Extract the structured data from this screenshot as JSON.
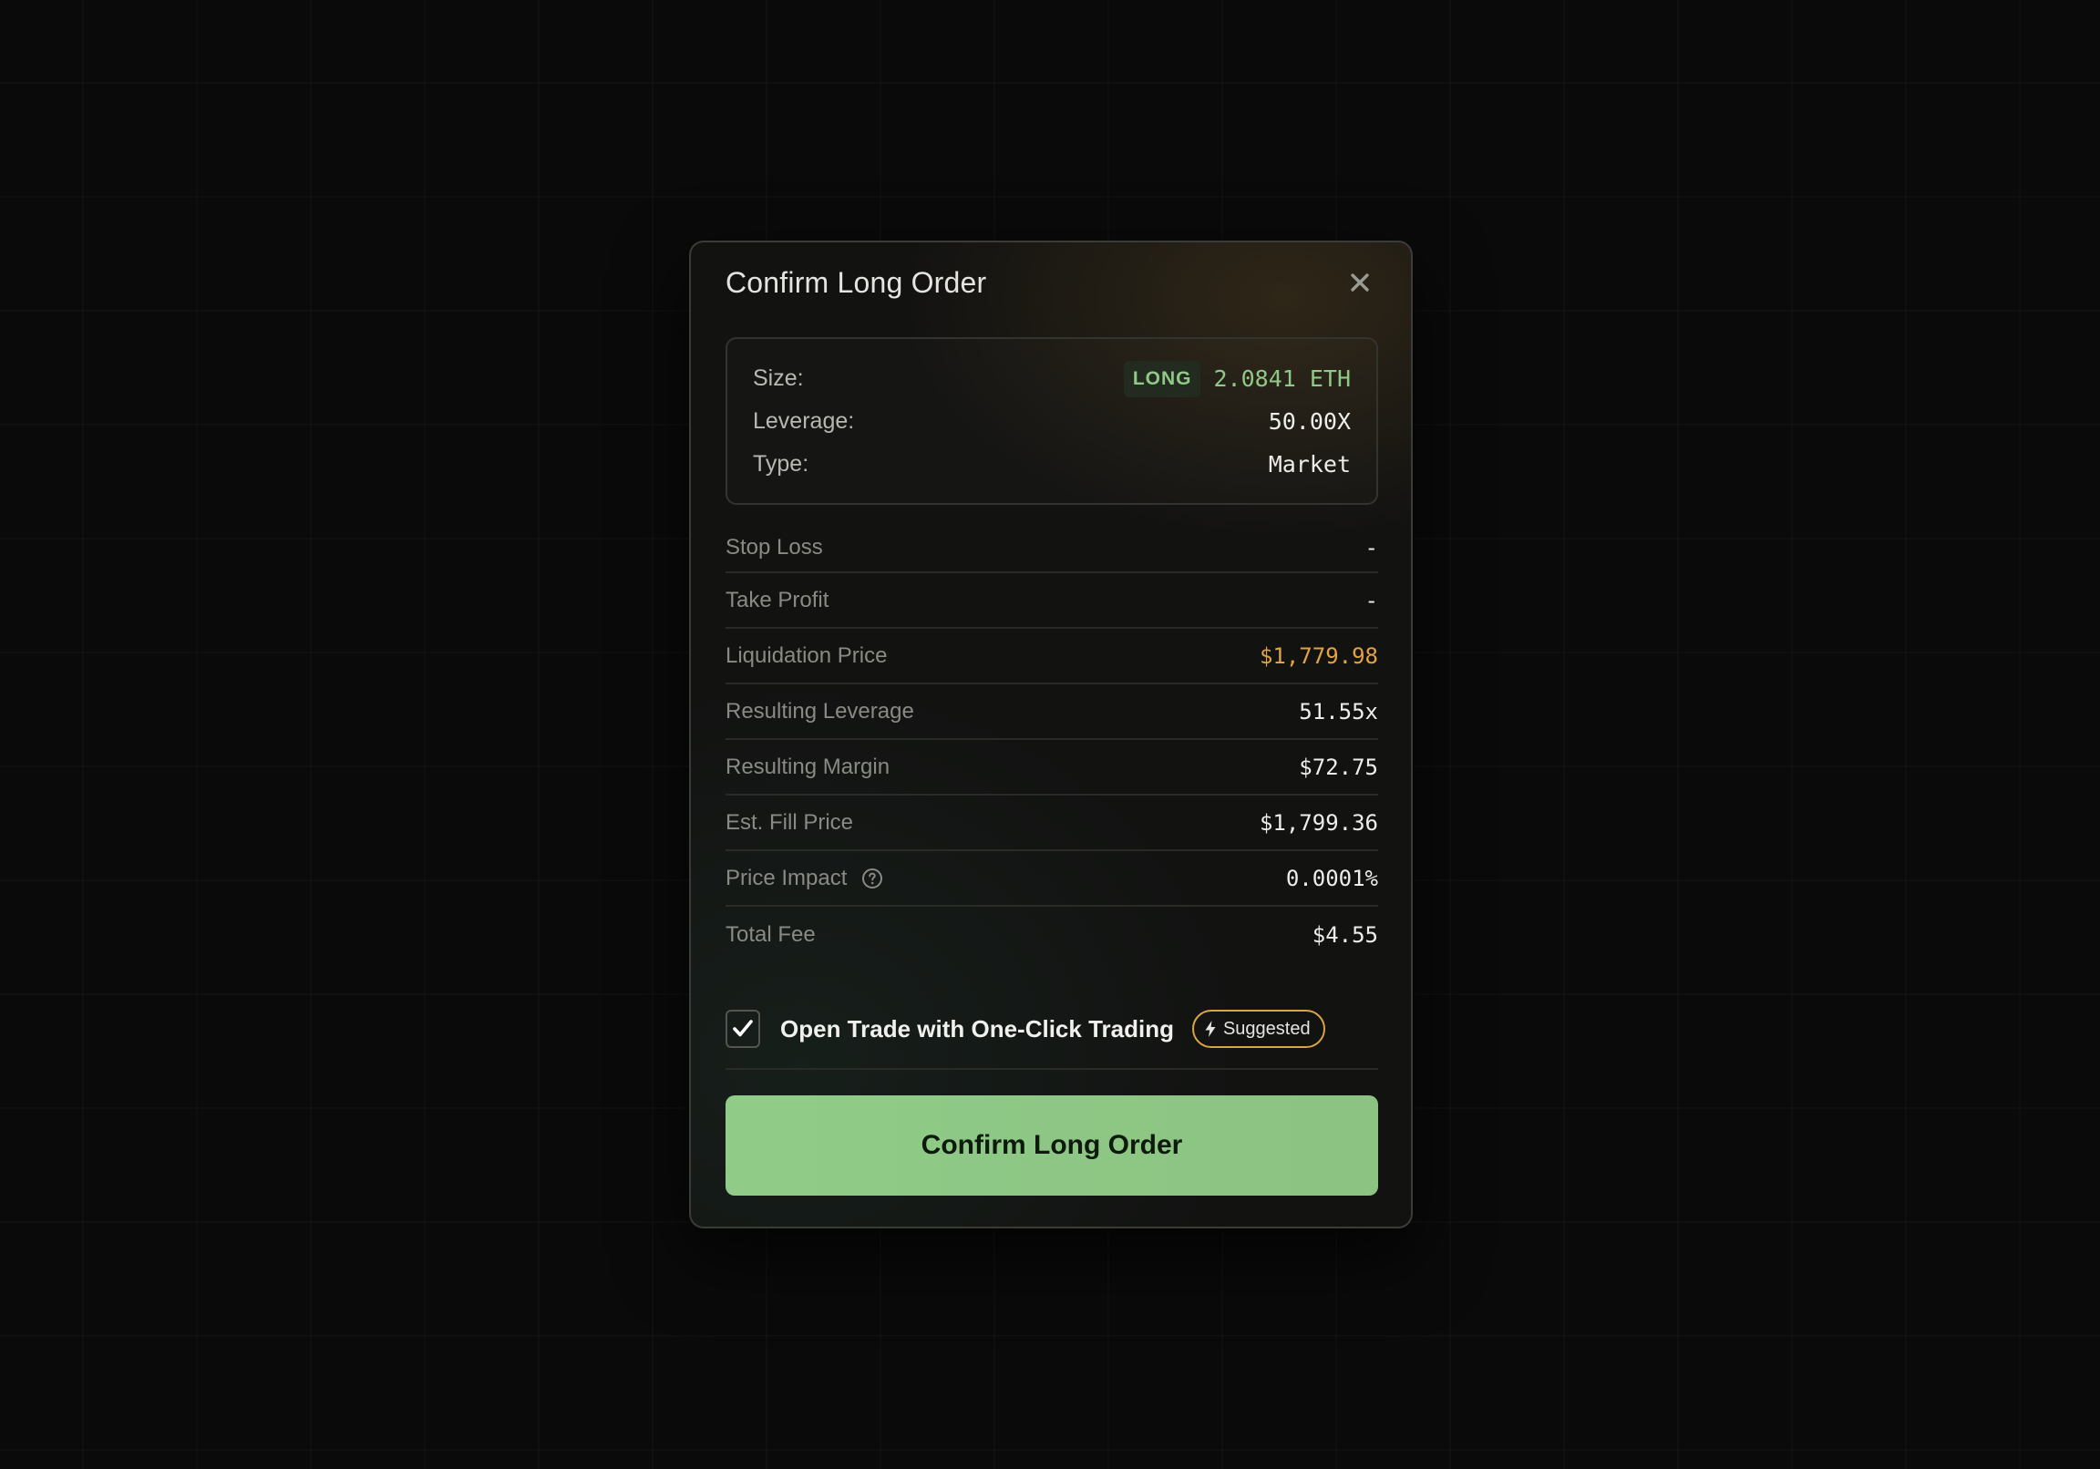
{
  "modal": {
    "title": "Confirm Long Order",
    "close_icon": "close-icon"
  },
  "summary": {
    "size_label": "Size:",
    "side_badge": "LONG",
    "size_value": "2.0841 ETH",
    "leverage_label": "Leverage:",
    "leverage_value": "50.00X",
    "type_label": "Type:",
    "type_value": "Market"
  },
  "details": [
    {
      "label": "Stop Loss",
      "value": "-"
    },
    {
      "label": "Take Profit",
      "value": "-"
    },
    {
      "label": "Liquidation Price",
      "value": "$1,779.98"
    },
    {
      "label": "Resulting Leverage",
      "value": "51.55x"
    },
    {
      "label": "Resulting Margin",
      "value": "$72.75"
    },
    {
      "label": "Est. Fill Price",
      "value": "$1,799.36"
    },
    {
      "label": "Price Impact",
      "value": "0.0001%"
    },
    {
      "label": "Total Fee",
      "value": "$4.55"
    }
  ],
  "one_click": {
    "checked": true,
    "label": "Open Trade with One-Click Trading",
    "badge": "Suggested",
    "badge_icon": "bolt-icon"
  },
  "confirm_button": "Confirm Long Order",
  "colors": {
    "accent_green": "#8fc985",
    "warning": "#e2a440",
    "button_bg": "#90cc88",
    "badge_border": "#d9a441"
  }
}
